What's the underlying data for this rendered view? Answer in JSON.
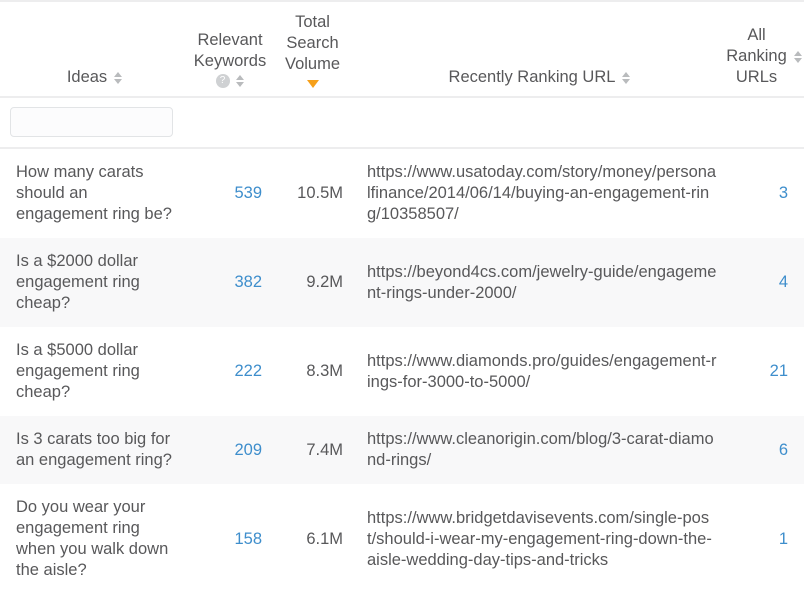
{
  "table": {
    "columns": [
      {
        "key": "ideas",
        "label": "Ideas",
        "sortable": true,
        "sort_state": "none",
        "has_help": false,
        "align": "left"
      },
      {
        "key": "kw",
        "label": "Relevant\nKeywords",
        "sortable": true,
        "sort_state": "none",
        "has_help": true,
        "help_glyph": "?",
        "align": "right"
      },
      {
        "key": "vol",
        "label": "Total\nSearch\nVolume",
        "sortable": true,
        "sort_state": "desc",
        "has_help": false,
        "align": "right"
      },
      {
        "key": "url",
        "label": "Recently Ranking URL",
        "sortable": true,
        "sort_state": "none",
        "has_help": false,
        "align": "left"
      },
      {
        "key": "all",
        "label": "All\nRanking\nURLs",
        "sortable": true,
        "sort_state": "none",
        "has_help": false,
        "align": "right"
      }
    ],
    "filter": {
      "value": "",
      "placeholder": ""
    },
    "rows": [
      {
        "idea": "How many carats should an engagement ring be?",
        "relevant_keywords": "539",
        "total_search_volume": "10.5M",
        "recently_ranking_url": "https://www.usatoday.com/story/money/personalfinance/2014/06/14/buying-an-engagement-ring/10358507/",
        "all_ranking_urls": "3"
      },
      {
        "idea": "Is a $2000 dollar engagement ring cheap?",
        "relevant_keywords": "382",
        "total_search_volume": "9.2M",
        "recently_ranking_url": "https://beyond4cs.com/jewelry-guide/engagement-rings-under-2000/",
        "all_ranking_urls": "4"
      },
      {
        "idea": "Is a $5000 dollar engagement ring cheap?",
        "relevant_keywords": "222",
        "total_search_volume": "8.3M",
        "recently_ranking_url": "https://www.diamonds.pro/guides/engagement-rings-for-3000-to-5000/",
        "all_ranking_urls": "21"
      },
      {
        "idea": "Is 3 carats too big for an engagement ring?",
        "relevant_keywords": "209",
        "total_search_volume": "7.4M",
        "recently_ranking_url": "https://www.cleanorigin.com/blog/3-carat-diamond-rings/",
        "all_ranking_urls": "6"
      },
      {
        "idea": "Do you wear your engagement ring when you walk down the aisle?",
        "relevant_keywords": "158",
        "total_search_volume": "6.1M",
        "recently_ranking_url": "https://www.bridgetdavisevents.com/single-post/should-i-wear-my-engagement-ring-down-the-aisle-wedding-day-tips-and-tricks",
        "all_ranking_urls": "1"
      }
    ]
  },
  "colors": {
    "link": "#3e8ecc",
    "text": "#58585a",
    "sort_active": "#f6a01a",
    "sort_inactive": "#b9bbbd",
    "row_alt": "#f8f8f9",
    "border": "#ededee"
  }
}
